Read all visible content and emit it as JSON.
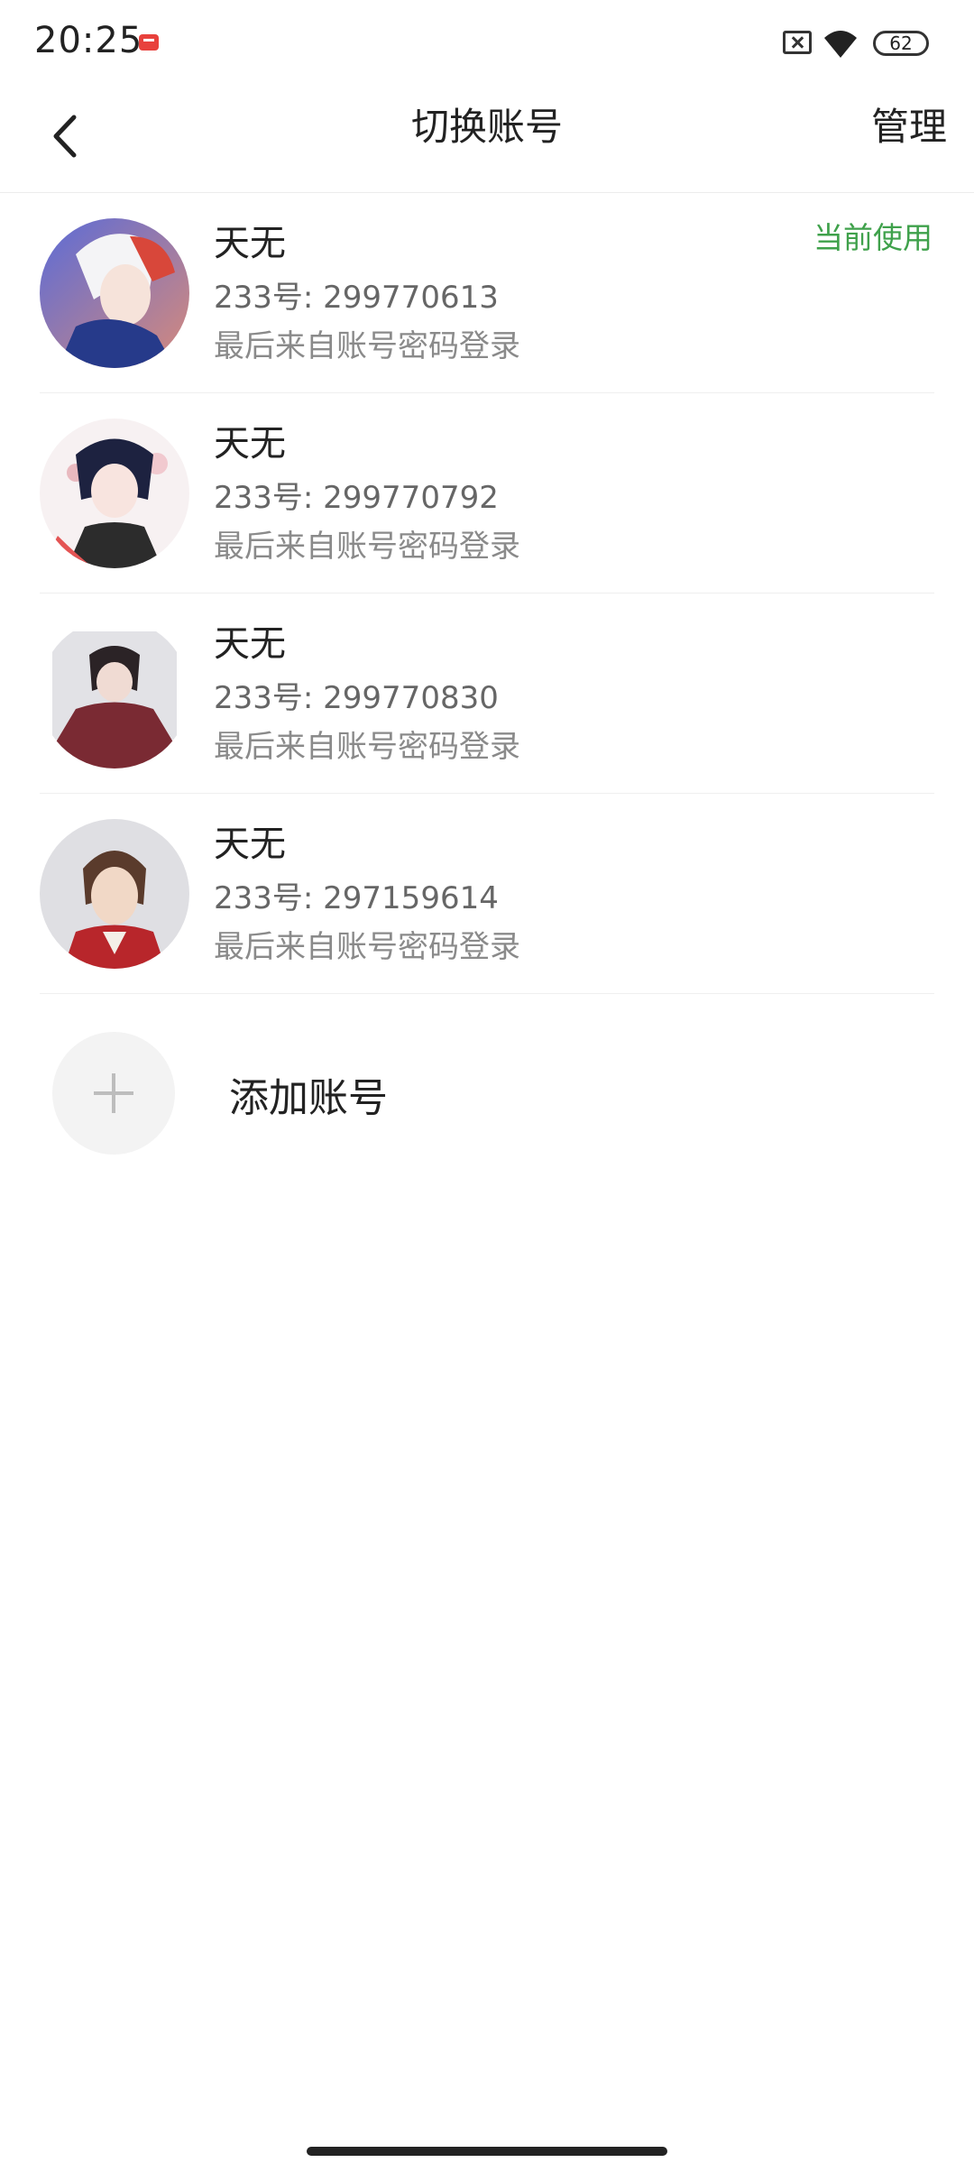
{
  "status_bar": {
    "time": "20:25",
    "battery_level": "62",
    "icons": [
      "app-notification-icon",
      "sim-off-icon",
      "wifi-icon",
      "battery-icon"
    ]
  },
  "header": {
    "title": "切换账号",
    "manage_label": "管理",
    "back_icon": "chevron-left-icon"
  },
  "accounts": [
    {
      "name": "天无",
      "id_line": "233号: 299770613",
      "login_line": "最后来自账号密码登录",
      "badge": "当前使用"
    },
    {
      "name": "天无",
      "id_line": "233号: 299770792",
      "login_line": "最后来自账号密码登录",
      "badge": ""
    },
    {
      "name": "天无",
      "id_line": "233号: 299770830",
      "login_line": "最后来自账号密码登录",
      "badge": ""
    },
    {
      "name": "天无",
      "id_line": "233号: 297159614",
      "login_line": "最后来自账号密码登录",
      "badge": ""
    }
  ],
  "add_account": {
    "label": "添加账号",
    "icon": "plus-icon"
  },
  "colors": {
    "accent_green": "#3fa14b",
    "text_primary": "#222222",
    "text_secondary": "#666666",
    "divider": "#efefef"
  }
}
